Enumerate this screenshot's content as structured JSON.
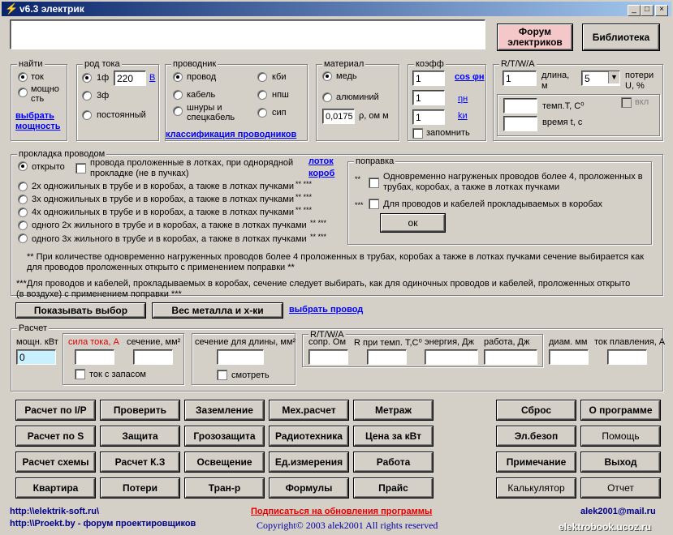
{
  "title": "v6.3 электрик",
  "top_buttons": {
    "forum": "Форум электриков",
    "library": "Библиотека"
  },
  "find": {
    "group": "найти",
    "tok": "ток",
    "power": "мощно сть",
    "select_power": "выбрать мощность"
  },
  "current_kind": {
    "group": "род тока",
    "ph1": "1ф",
    "voltage": "220",
    "v": "B",
    "ph3": "3ф",
    "dc": "постоянный"
  },
  "conductor": {
    "group": "проводник",
    "wire": "провод",
    "cable": "кабель",
    "cords": "шнуры и спецкабель",
    "kbi": "кби",
    "nsh": "нпш",
    "sip": "сип",
    "classification": "классификация проводников"
  },
  "material": {
    "group": "материал",
    "copper": "медь",
    "aluminium": "алюминий",
    "rho": "0,0175",
    "rho_unit": "ρ, ом м"
  },
  "coeff": {
    "group": "коэфф",
    "k1": "1",
    "k2": "1",
    "k3": "1",
    "cos": "cos φн",
    "eta": "ηн",
    "ki": "kи",
    "remember": "запомнить"
  },
  "rtwa": {
    "group": "R/T/W/A",
    "length": "1",
    "length_label": "длина, м",
    "loss": "5",
    "loss_label": "потери U, %",
    "temp_label": "темп.T, C⁰",
    "time_label": "время t, c",
    "enable": "вкл"
  },
  "laying": {
    "group": "прокладка проводом",
    "open": "открыто",
    "trays": "провода проложенные в лотках, при однорядной прокладке (не в пучках)",
    "tray_link": "лоток",
    "box_link": "короб",
    "opt2": "2х одножильных в трубе и в коробах, а также в лотках пучками",
    "opt2s": "** ***",
    "opt3": "3х одножильных в трубе и в коробах, а также в лотках пучками",
    "opt3s": "** ***",
    "opt4": "4х одножильных в трубе и в коробах, а также в лотках пучками",
    "opt4s": "** ***",
    "opt5": "одного 2х жильного в трубе и в коробах, а также в лотках пучками",
    "opt5s": "** ***",
    "opt6": "одного 3х жильного в трубе и в коробах, а также в лотках пучками",
    "opt6s": "** ***"
  },
  "correction": {
    "group": "поправка",
    "m1": "**",
    "c1": "Одновременно нагруженых проводов более 4, проложенных в трубах, коробах, а также в лотках пучками",
    "m2": "***",
    "c2": "Для проводов и кабелей прокладываемых в коробах",
    "ok": "ок"
  },
  "notes": {
    "n1": "** При количестве одновременно нагруженных проводов более 4 проложенных в трубах, коробах а также в лотках пучками сечение выбирается как для проводов проложенных открыто с применением поправки **",
    "n2": "***Для проводов и кабелей, прокладываемых в коробах, сечение следует выбирать, как для одиночных проводов и кабелей, проложенных открыто (в воздухе) с применением поправки ***"
  },
  "mid_buttons": {
    "show": "Показывать выбор",
    "metal": "Вес металла и х-ки",
    "select_wire": "выбрать провод"
  },
  "calc": {
    "group": "Расчет",
    "power_label": "мощн. кВт",
    "power_value": "0",
    "current_label": "сила тока, А",
    "section_label": "сечение, мм²",
    "reserve": "ток с запасом",
    "section_len_label": "сечение для длины, мм²",
    "watch": "смотреть",
    "rtwa": "R/T/W/A",
    "r_label": "сопр. Ом",
    "rt_label": "R при темп. T,C⁰",
    "energy_label": "энергия, Дж",
    "work_label": "работа, Дж",
    "diam_label": "диам. мм",
    "melt_label": "ток плавления, А"
  },
  "buttons": {
    "b1": "Расчет по I/P",
    "b2": "Проверить",
    "b3": "Заземление",
    "b4": "Мех.расчет",
    "b5": "Метраж",
    "b6": "Сброс",
    "b7": "О программе",
    "b8": "Расчет по S",
    "b9": "Защита",
    "b10": "Грозозащита",
    "b11": "Радиотехника",
    "b12": "Цена за кВт",
    "b13": "Эл.безоп",
    "b14": "Помощь",
    "b15": "Расчет схемы",
    "b16": "Расчет К.З",
    "b17": "Освещение",
    "b18": "Ед.измерения",
    "b19": "Работа",
    "b20": "Примечание",
    "b21": "Выход",
    "b22": "Квартира",
    "b23": "Потери",
    "b24": "Тран-р",
    "b25": "Формулы",
    "b26": "Прайс",
    "b27": "Калькулятор",
    "b28": "Отчет"
  },
  "footer": {
    "site1": "http:\\\\elektrik-soft.ru\\",
    "site2": "http:\\\\Proekt.by - форум проектировщиков",
    "subscribe": "Подписаться на обновления программы",
    "copyright": "Copyright© 2003 alek2001 All rights reserved",
    "email": "alek2001@mail.ru",
    "watermark": "elektrobook.ucoz.ru"
  },
  "colors": {
    "accent_red": "#e00000",
    "link": "#0000ff",
    "forum_bg": "#f4c8c8"
  }
}
